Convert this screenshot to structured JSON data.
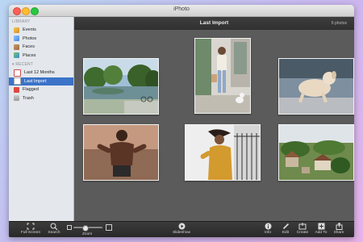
{
  "window": {
    "title": "iPhoto"
  },
  "sidebar": {
    "sections": [
      {
        "heading": "LIBRARY",
        "items": [
          {
            "label": "Events",
            "icon": "events-icon"
          },
          {
            "label": "Photos",
            "icon": "photos-icon"
          },
          {
            "label": "Faces",
            "icon": "faces-icon"
          },
          {
            "label": "Places",
            "icon": "places-icon"
          }
        ]
      },
      {
        "heading": "RECENT",
        "items": [
          {
            "label": "Last 12 Months",
            "icon": "calendar-icon"
          },
          {
            "label": "Last Import",
            "icon": "import-clock-icon",
            "selected": true
          },
          {
            "label": "Flagged",
            "icon": "flag-icon"
          },
          {
            "label": "Trash",
            "icon": "trash-icon"
          }
        ]
      }
    ]
  },
  "main": {
    "title": "Last Import",
    "photo_count": "6 photos",
    "photos": [
      {
        "subject": "lake-trees"
      },
      {
        "subject": "woman-walking-dog"
      },
      {
        "subject": "running-dog"
      },
      {
        "subject": "shirtless-man"
      },
      {
        "subject": "woman-hair-blowing"
      },
      {
        "subject": "hillside-houses"
      }
    ]
  },
  "toolbar": {
    "fullscreen_label": "Full Screen",
    "search_label": "Search",
    "zoom_label": "Zoom",
    "zoom_level": 0.35,
    "slideshow_label": "Slideshow",
    "info_label": "Info",
    "edit_label": "Edit",
    "create_label": "Create",
    "addto_label": "Add To",
    "share_label": "Share"
  },
  "colors": {
    "selection": "#3b73c8",
    "main_bg": "#5b5b5b",
    "toolbar_bg": "#2f2f2f"
  }
}
